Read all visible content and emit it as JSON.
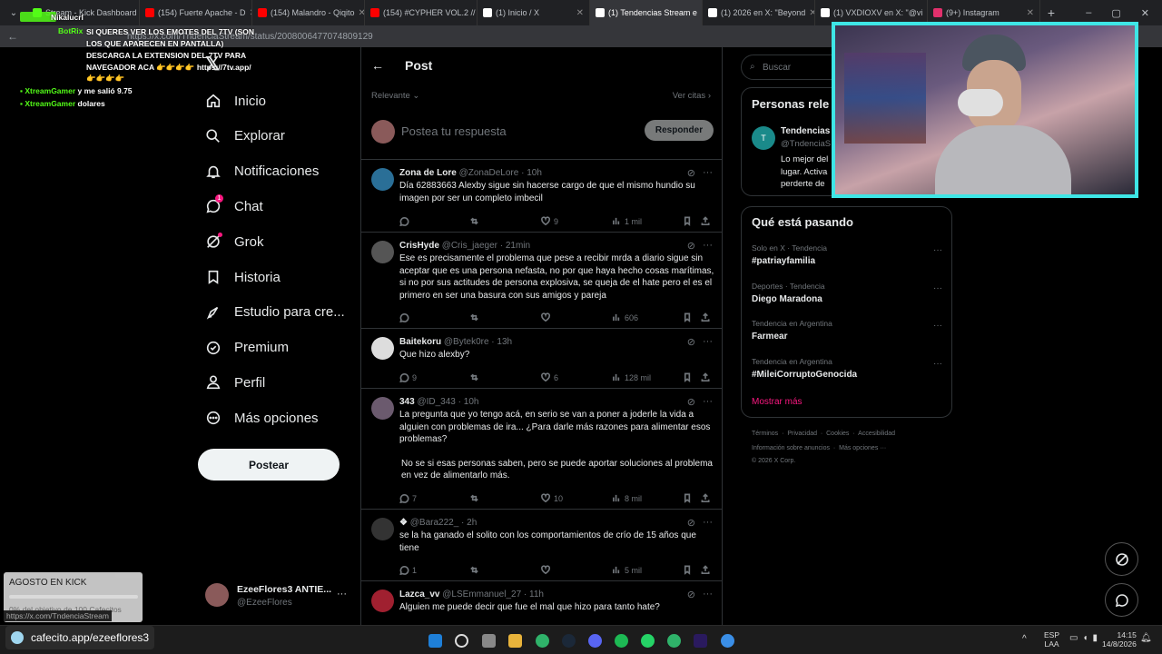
{
  "browser": {
    "tabs": [
      {
        "label": "Stream - Kick Dashboard",
        "color": "#53fc18",
        "active": false
      },
      {
        "label": "(154) Fuerte Apache - D",
        "color": "#ff0000",
        "active": false
      },
      {
        "label": "(154) Malandro - Qiqito",
        "color": "#ff0000",
        "active": false
      },
      {
        "label": "(154) #CYPHER VOL.2 //",
        "color": "#ff0000",
        "active": false
      },
      {
        "label": "(1) Inicio / X",
        "color": "#ffffff",
        "active": false
      },
      {
        "label": "(1) Tendencias Stream e",
        "color": "#ffffff",
        "active": true
      },
      {
        "label": "(1) 2026 en X: \"Beyond",
        "color": "#ffffff",
        "active": false
      },
      {
        "label": "(1) VXDIOXV en X: \"@vi",
        "color": "#ffffff",
        "active": false
      },
      {
        "label": "(9+) Instagram",
        "color": "#e1306c",
        "active": false
      }
    ],
    "url": "https://x.com/TndenciaStream/status/2008006477074809129"
  },
  "overlay": {
    "bot_notice_user": "BotRix",
    "bot_notice_top_user": "Nikalucrl",
    "bot_notice": [
      "SI QUERES VER LOS EMOTES DEL 7TV (SON",
      "LOS QUE APARECEN EN PANTALLA)",
      "DESCARGA LA EXTENSION DEL 7TV PARA",
      "NAVEGADOR ACA 👉👉👉👉 https://7tv.app/",
      "👉👉👉👉"
    ],
    "chat": [
      {
        "user": "XtreamGamer",
        "msg": "y me salió 9.75"
      },
      {
        "user": "XtreamGamer",
        "msg": "dolares"
      }
    ],
    "goal_title": "AGOSTO EN KICK",
    "goal_text": "0% del objetivo de 100 Cafecitos",
    "goal_progress": 0,
    "status_url": "https://x.com/TndenciaStream",
    "cafecito": "cafecito.app/ezeeflores3"
  },
  "nav": {
    "items": [
      {
        "label": "Inicio",
        "icon": "home-icon"
      },
      {
        "label": "Explorar",
        "icon": "search-icon"
      },
      {
        "label": "Notificaciones",
        "icon": "bell-icon"
      },
      {
        "label": "Chat",
        "icon": "chat-icon",
        "badge": "1"
      },
      {
        "label": "Grok",
        "icon": "grok-icon"
      },
      {
        "label": "Historia",
        "icon": "bookmark-icon"
      },
      {
        "label": "Estudio para cre...",
        "icon": "rocket-icon"
      },
      {
        "label": "Premium",
        "icon": "verified-icon"
      },
      {
        "label": "Perfil",
        "icon": "person-icon"
      },
      {
        "label": "Más opciones",
        "icon": "more-circle-icon"
      }
    ],
    "post_button": "Postear",
    "account_name": "EzeeFlores3 ANTIE...",
    "account_handle": "@EzeeFlores"
  },
  "post": {
    "header": "Post",
    "sort_label": "Relevante",
    "quotes_link": "Ver citas",
    "reply_placeholder": "Postea tu respuesta",
    "reply_button": "Responder"
  },
  "replies": [
    {
      "name": "Zona de Lore",
      "handle": "@ZonaDeLore · 10h",
      "text": [
        "Día 62883663 Alexby sigue sin hacerse cargo de que el mismo hundio su imagen por ser un completo imbecil"
      ],
      "likes": "9",
      "views": "1 mil",
      "avatar": "#2a6f97"
    },
    {
      "name": "CrisHyde",
      "handle": "@Cris_jaeger · 21min",
      "text": [
        "Ese es precisamente el problema que pese a recibir mrda a diario sigue sin aceptar que es una persona nefasta, no por que haya hecho cosas marítimas, si no por sus actitudes de persona explosiva, se queja de el hate pero el es el primero en ser una basura con sus amigos y pareja"
      ],
      "likes": "",
      "views": "606",
      "avatar": "#555"
    },
    {
      "name": "Baitekoru",
      "handle": "@Bytek0re · 13h",
      "text": [
        "Que hizo alexby?"
      ],
      "replies": "9",
      "likes": "6",
      "views": "128 mil",
      "avatar": "#ddd"
    },
    {
      "name": "343",
      "handle": "@ID_343 · 10h",
      "text": [
        "La pregunta que yo tengo acá, en serio se van a poner a joderle la vida a alguien con problemas de ira... ¿Para darle más razones para alimentar esos problemas?",
        "No se si esas personas saben, pero se puede aportar soluciones al problema en vez de alimentarlo más."
      ],
      "replies": "7",
      "likes": "10",
      "views": "8 mil",
      "avatar": "#6b5a6e"
    },
    {
      "name": "❖",
      "handle": "@Bara222_ · 2h",
      "text": [
        "se la ha ganado el solito con los comportamientos de crío de 15 años que tiene"
      ],
      "replies": "1",
      "likes": "",
      "views": "5 mil",
      "avatar": "#333"
    },
    {
      "name": "Lazca_vv",
      "handle": "@LSEmmanuel_27 · 11h",
      "text": [
        "Alguien me puede decir que fue el mal que hizo para tanto hate?"
      ],
      "likes": "",
      "views": "",
      "avatar": "#a02030"
    }
  ],
  "search": {
    "placeholder": "Buscar"
  },
  "relevant": {
    "title": "Personas rele",
    "name": "Tendencias",
    "handle": "@TndenciaS",
    "bio": [
      "Lo mejor del",
      "lugar. Activa",
      "perderte de"
    ]
  },
  "trends": {
    "title": "Qué está pasando",
    "items": [
      {
        "context": "Solo en X · Tendencia",
        "name": "#patriayfamilia"
      },
      {
        "context": "Deportes · Tendencia",
        "name": "Diego Maradona"
      },
      {
        "context": "Tendencia en Argentina",
        "name": "Farmear"
      },
      {
        "context": "Tendencia en Argentina",
        "name": "#MileiCorruptoGenocida"
      }
    ],
    "show_more": "Mostrar más"
  },
  "footer": {
    "line1": [
      "Términos",
      "Privacidad",
      "Cookies",
      "Accesibilidad"
    ],
    "line2": [
      "Información sobre anuncios",
      "Más opciones ···"
    ],
    "copyright": "© 2026 X Corp."
  },
  "taskbar": {
    "lang": "ESP",
    "lang2": "LAA",
    "time": "14:15",
    "date": "14/8/2026"
  },
  "colors": {
    "accent": "#f91880",
    "cam_border": "#3ee6e6",
    "kick": "#53fc18"
  }
}
